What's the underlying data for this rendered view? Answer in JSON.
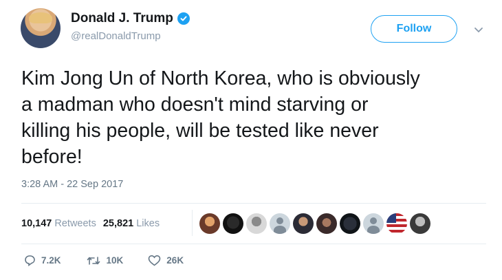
{
  "author": {
    "display_name": "Donald J. Trump",
    "handle": "@realDonaldTrump",
    "avatar_icon": "profile-photo",
    "verified_icon": "verified-badge-icon"
  },
  "follow_button": {
    "label": "Follow"
  },
  "menu": {
    "icon": "chevron-down-icon"
  },
  "tweet": {
    "text": "Kim Jong Un of North Korea, who is obviously\na madman who doesn't mind starving or\nkilling his people, will be tested like never\nbefore!",
    "timestamp": "3:28 AM - 22 Sep 2017"
  },
  "stats": {
    "retweets_count": "10,147",
    "retweets_label": "Retweets",
    "likes_count": "25,821",
    "likes_label": "Likes"
  },
  "liker_avatars": [
    {
      "icon": "profile-photo"
    },
    {
      "icon": "profile-photo"
    },
    {
      "icon": "profile-photo"
    },
    {
      "icon": "default-profile-icon"
    },
    {
      "icon": "profile-photo"
    },
    {
      "icon": "profile-photo"
    },
    {
      "icon": "profile-photo"
    },
    {
      "icon": "default-profile-icon"
    },
    {
      "icon": "profile-photo"
    },
    {
      "icon": "profile-photo"
    }
  ],
  "actions": {
    "replies": "7.2K",
    "retweets": "10K",
    "likes": "26K"
  },
  "colors": {
    "accent": "#1da1f2",
    "text": "#14171a",
    "muted": "#657786",
    "divider": "#e6ecf0"
  }
}
